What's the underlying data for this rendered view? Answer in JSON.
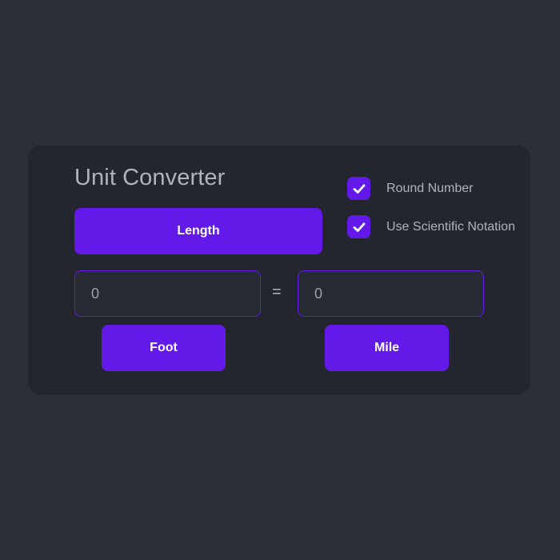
{
  "card": {
    "title": "Unit Converter"
  },
  "converter": {
    "type_label": "Length",
    "from_value": "0",
    "to_value": "0",
    "equals_sign": "=",
    "from_unit": "Foot",
    "to_unit": "Mile"
  },
  "options": [
    {
      "label": "Round Number",
      "checked": true,
      "icon": "check-icon"
    },
    {
      "label": "Use Scientific Notation",
      "checked": true,
      "icon": "check-icon"
    }
  ],
  "colors": {
    "background": "#2a2f3a",
    "card": "#23262e",
    "accent": "#6319e8",
    "text": "#aeb3bc"
  }
}
